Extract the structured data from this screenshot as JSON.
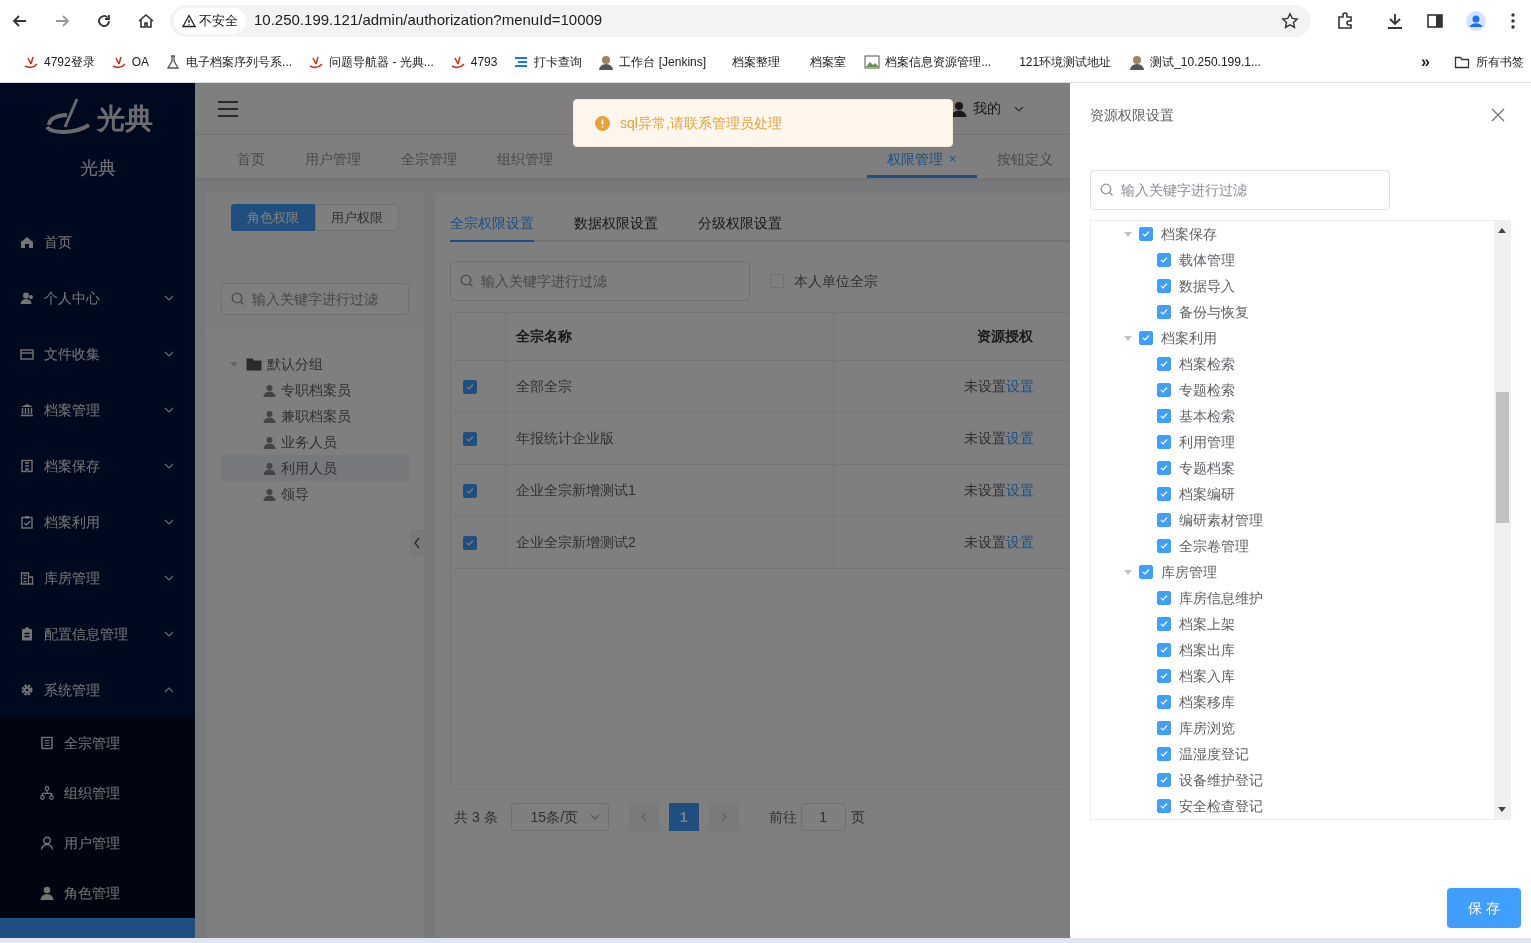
{
  "browser": {
    "security": "不安全",
    "url": "10.250.199.121/admin/authorization?menuId=10009",
    "bookmarks": [
      "4792登录",
      "OA",
      "电子档案序列号系...",
      "问题导航器 - 光典...",
      "4793",
      "打卡查询",
      "工作台 [Jenkins]",
      "档案整理",
      "档案室",
      "档案信息资源管理...",
      "121环境测试地址",
      "测试_10.250.199.1..."
    ],
    "overflow": "»",
    "all_bookmarks": "所有书签"
  },
  "sidebar": {
    "logo_text": "光典",
    "brand": "光典",
    "items": [
      {
        "label": "首页"
      },
      {
        "label": "个人中心",
        "expanded": false
      },
      {
        "label": "文件收集",
        "expanded": false
      },
      {
        "label": "档案管理",
        "expanded": false
      },
      {
        "label": "档案保存",
        "expanded": false
      },
      {
        "label": "档案利用",
        "expanded": false
      },
      {
        "label": "库房管理",
        "expanded": false
      },
      {
        "label": "配置信息管理",
        "expanded": false
      },
      {
        "label": "系统管理",
        "expanded": true,
        "children": [
          {
            "label": "全宗管理",
            "selected": false
          },
          {
            "label": "组织管理",
            "selected": false
          },
          {
            "label": "用户管理",
            "selected": false
          },
          {
            "label": "角色管理",
            "selected": false
          },
          {
            "selected": true
          }
        ]
      }
    ]
  },
  "header": {
    "user": "我的"
  },
  "tabs": [
    {
      "label": "首页",
      "selected": false,
      "closable": false
    },
    {
      "label": "用户管理",
      "selected": false,
      "closable": false
    },
    {
      "label": "全宗管理",
      "selected": false,
      "closable": false
    },
    {
      "label": "组织管理",
      "selected": false,
      "closable": false
    },
    {
      "label": "权限管理",
      "selected": true,
      "closable": true,
      "close": "×"
    },
    {
      "label": "按钮定义",
      "selected": false,
      "closable": false
    }
  ],
  "toast": {
    "kind": "warning",
    "message": "sql异常,请联系管理员处理"
  },
  "role_panel": {
    "modes": [
      {
        "label": "角色权限",
        "selected": true
      },
      {
        "label": "用户权限",
        "selected": false
      }
    ],
    "search": {
      "placeholder": "输入关键字进行过滤"
    },
    "tree": [
      {
        "label": "默认分组",
        "expanded": true,
        "children": [
          {
            "label": "专职档案员",
            "selected": false
          },
          {
            "label": "兼职档案员",
            "selected": false
          },
          {
            "label": "业务人员",
            "selected": false
          },
          {
            "label": "利用人员",
            "selected": true
          },
          {
            "label": "领导",
            "selected": false
          }
        ]
      }
    ]
  },
  "content": {
    "tabs": [
      {
        "label": "全宗权限设置",
        "selected": true
      },
      {
        "label": "数据权限设置",
        "selected": false
      },
      {
        "label": "分级权限设置",
        "selected": false
      }
    ],
    "search": {
      "placeholder": "输入关键字进行过滤"
    },
    "own_unit": {
      "label": "本人单位全宗",
      "checked": false
    },
    "table": {
      "columns": [
        "全宗名称",
        "资源授权"
      ],
      "rows": [
        {
          "checked": true,
          "name": "全部全宗",
          "status": "未设置",
          "action": "设置"
        },
        {
          "checked": true,
          "name": "年报统计企业版",
          "status": "未设置",
          "action": "设置"
        },
        {
          "checked": true,
          "name": "企业全宗新增测试1",
          "status": "未设置",
          "action": "设置"
        },
        {
          "checked": true,
          "name": "企业全宗新增测试2",
          "status": "未设置",
          "action": "设置"
        }
      ]
    },
    "pagination": {
      "total": "共 3 条",
      "page_size": "15条/页",
      "pages": [
        {
          "label": "1",
          "selected": true
        }
      ],
      "goto": "前往",
      "goto_value": "1",
      "suffix": "页"
    }
  },
  "drawer": {
    "title": "资源权限设置",
    "search": {
      "placeholder": "输入关键字进行过滤"
    },
    "tree": [
      {
        "label": "档案保存",
        "checked": true,
        "expanded": true,
        "children": [
          {
            "label": "载体管理",
            "checked": true
          },
          {
            "label": "数据导入",
            "checked": true
          },
          {
            "label": "备份与恢复",
            "checked": true
          }
        ]
      },
      {
        "label": "档案利用",
        "checked": true,
        "expanded": true,
        "children": [
          {
            "label": "档案检索",
            "checked": true
          },
          {
            "label": "专题检索",
            "checked": true
          },
          {
            "label": "基本检索",
            "checked": true
          },
          {
            "label": "利用管理",
            "checked": true
          },
          {
            "label": "专题档案",
            "checked": true
          },
          {
            "label": "档案编研",
            "checked": true
          },
          {
            "label": "编研素材管理",
            "checked": true
          },
          {
            "label": "全宗卷管理",
            "checked": true
          }
        ]
      },
      {
        "label": "库房管理",
        "checked": true,
        "expanded": true,
        "children": [
          {
            "label": "库房信息维护",
            "checked": true
          },
          {
            "label": "档案上架",
            "checked": true
          },
          {
            "label": "档案出库",
            "checked": true
          },
          {
            "label": "档案入库",
            "checked": true
          },
          {
            "label": "档案移库",
            "checked": true
          },
          {
            "label": "库房浏览",
            "checked": true
          },
          {
            "label": "温湿度登记",
            "checked": true
          },
          {
            "label": "设备维护登记",
            "checked": true
          },
          {
            "label": "安全检查登记",
            "checked": true
          }
        ]
      }
    ],
    "save": "保 存"
  }
}
